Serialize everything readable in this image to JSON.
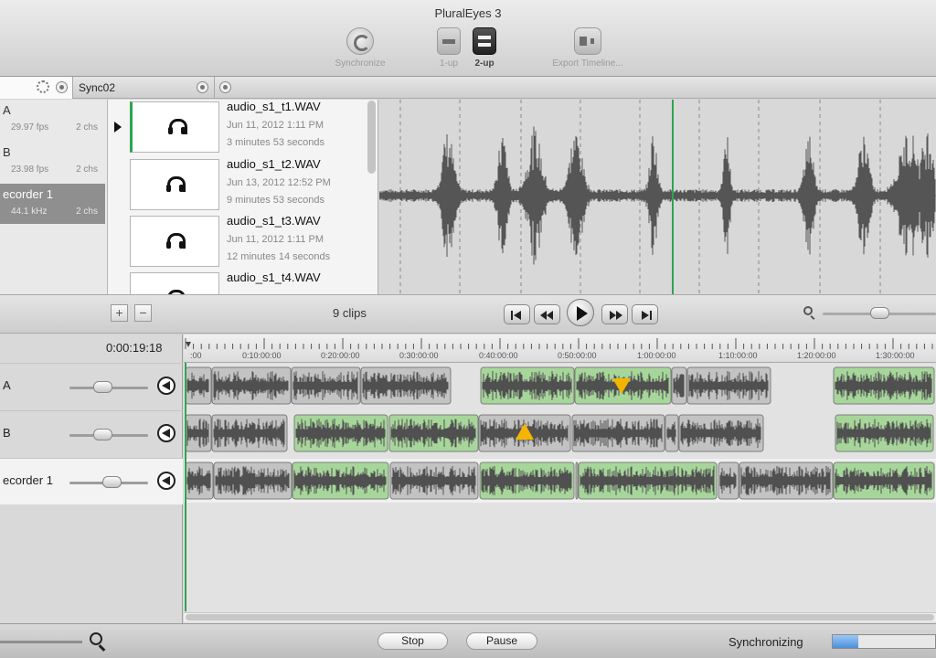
{
  "window": {
    "title": "PluralEyes 3"
  },
  "toolbar": {
    "synchronize": "Synchronize",
    "one_up": "1-up",
    "two_up": "2-up",
    "export": "Export Timeline..."
  },
  "tabs": {
    "second": "Sync02"
  },
  "sources": [
    {
      "name": "A",
      "rate": "29.97 fps",
      "channels": "2 chs"
    },
    {
      "name": "B",
      "rate": "23.98 fps",
      "channels": "2 chs"
    },
    {
      "name": "ecorder 1",
      "rate": "44.1 kHz",
      "channels": "2 chs"
    }
  ],
  "clips": [
    {
      "name": "audio_s1_t1.WAV",
      "date": "Jun 11, 2012 1:11 PM",
      "duration": "3 minutes 53 seconds",
      "icon": "headphones-icon"
    },
    {
      "name": "audio_s1_t2.WAV",
      "date": "Jun 13, 2012 12:52 PM",
      "duration": "9 minutes 53 seconds",
      "icon": "headphones-icon"
    },
    {
      "name": "audio_s1_t3.WAV",
      "date": "Jun 11, 2012 1:11 PM",
      "duration": "12 minutes 14 seconds",
      "icon": "headphones-icon"
    },
    {
      "name": "audio_s1_t4.WAV",
      "date": "",
      "duration": "",
      "icon": "headphones-icon"
    }
  ],
  "clip_controls": {
    "add": "+",
    "remove": "−",
    "count": "9 clips"
  },
  "timeline": {
    "timecode": "0:00:19:18",
    "ruler": [
      ":00",
      "0:10:00:00",
      "0:20:00:00",
      "0:30:00:00",
      "0:40:00:00",
      "0:50:00:00",
      "1:00:00:00",
      "1:10:00:00",
      "1:20:00:00",
      "1:30:00:00"
    ],
    "tracks": [
      {
        "name": "A",
        "volume": 0.4
      },
      {
        "name": "B",
        "volume": 0.4
      },
      {
        "name": "ecorder 1",
        "volume": 0.55
      }
    ]
  },
  "status": {
    "stop": "Stop",
    "pause": "Pause",
    "state": "Synchronizing",
    "progress": 0.25
  },
  "colors": {
    "synced_clip": "#a7d69b",
    "unsynced_clip": "#c3c3c3",
    "waveform": "#555555",
    "playhead": "#2ea44f",
    "marker": "#f4b400"
  }
}
